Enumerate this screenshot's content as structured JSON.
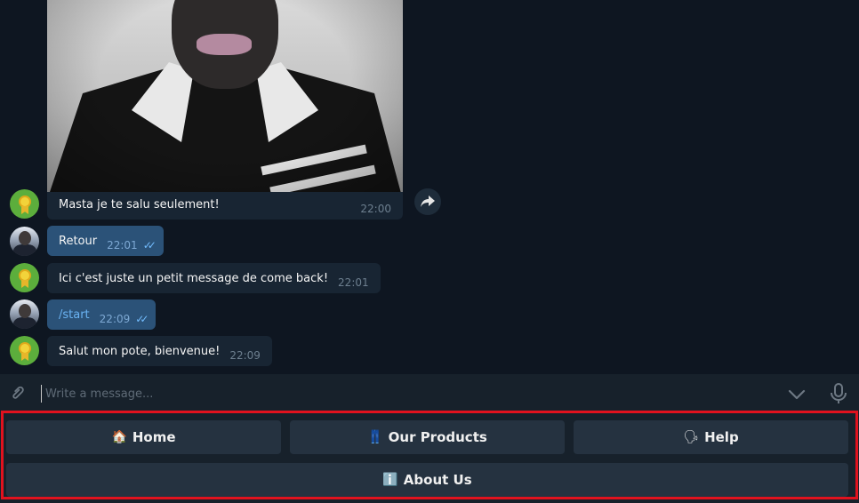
{
  "messages": [
    {
      "sender": "bot",
      "text": "Masta je te salu seulement!",
      "time": "22:00",
      "has_photo": true
    },
    {
      "sender": "user",
      "text": "Retour",
      "time": "22:01",
      "status": "read"
    },
    {
      "sender": "bot",
      "text": "Ici c'est juste un petit message de come back!",
      "time": "22:01"
    },
    {
      "sender": "user",
      "text": "/start",
      "time": "22:09",
      "status": "read"
    },
    {
      "sender": "bot",
      "text": "Salut mon pote, bienvenue!",
      "time": "22:09"
    }
  ],
  "icons": {
    "forward": "share-arrow-icon",
    "attach": "paperclip-icon",
    "scroll_down": "chevron-down-icon",
    "mic": "microphone-icon",
    "read_status": "double-check-icon"
  },
  "composer": {
    "placeholder": "Write a message..."
  },
  "keyboard": {
    "home": {
      "emoji": "🏠",
      "label": "Home"
    },
    "products": {
      "emoji": "👖",
      "label": "Our Products"
    },
    "help": {
      "emoji": "🗣",
      "label": "Help"
    },
    "about": {
      "emoji": "ℹ️",
      "label": "About Us"
    }
  },
  "colors": {
    "background": "#0e1621",
    "incoming_bubble": "#182533",
    "outgoing_bubble": "#2b5278",
    "keyboard_button": "#253240",
    "highlight": "#e1121e",
    "link": "#6ab3f3"
  }
}
